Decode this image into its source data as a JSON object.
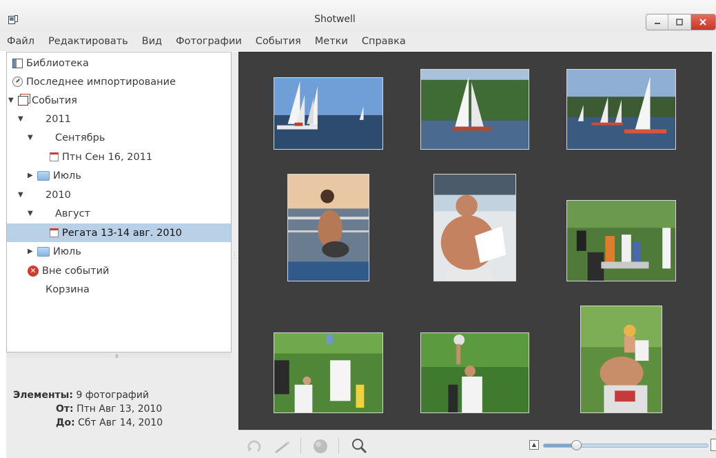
{
  "window": {
    "title": "Shotwell"
  },
  "menu": [
    "Файл",
    "Редактировать",
    "Вид",
    "Фотографии",
    "События",
    "Метки",
    "Справка"
  ],
  "sidebar": {
    "library": "Библиотека",
    "last_import": "Последнее импортирование",
    "events": "События",
    "year_2011": "2011",
    "month_sep": "Сентябрь",
    "event_sep16": "Птн Сен 16, 2011",
    "month_jul_2011": "Июль",
    "year_2010": "2010",
    "month_aug": "Август",
    "event_regatta": "Регата 13-14 авг. 2010",
    "month_jul_2010": "Июль",
    "no_event": "Вне событий",
    "trash": "Корзина"
  },
  "info": {
    "items_label": "Элементы:",
    "items_value": "9 фотографий",
    "from_label": "От:",
    "from_value": "Птн Авг 13, 2010",
    "to_label": "До:",
    "to_value": "Сбт Авг 14, 2010"
  },
  "photos": [
    "sailboats-race",
    "sailboat-near-shore",
    "sailboats-group",
    "girl-on-pier",
    "man-with-paper",
    "award-ceremony",
    "men-raising-cup",
    "man-holding-trophy",
    "child-on-shoulders"
  ],
  "toolbar": {
    "icons": [
      "rotate-icon",
      "enhance-icon",
      "publish-icon",
      "search-icon"
    ],
    "zoom_level": 0.2
  },
  "colors": {
    "selection": "#b9d1e6",
    "viewer_bg": "#3e3e3e",
    "close_button": "#d0402f"
  }
}
